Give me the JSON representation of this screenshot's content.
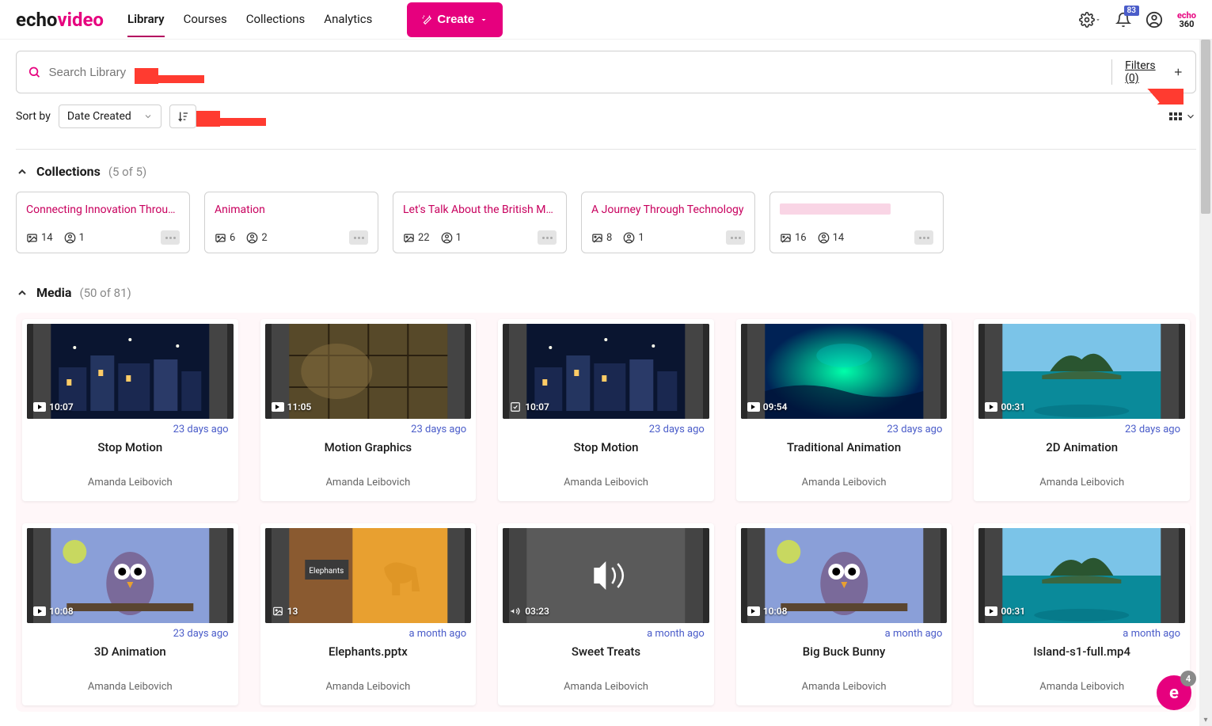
{
  "brand": {
    "part1": "echo",
    "part2": "video",
    "mini1": "echo",
    "mini2": "360"
  },
  "nav": {
    "library": "Library",
    "courses": "Courses",
    "collections": "Collections",
    "analytics": "Analytics"
  },
  "create_btn": "Create",
  "notification_count": "83",
  "search": {
    "placeholder": "Search Library"
  },
  "filters": {
    "label": "Filters (0)"
  },
  "sort": {
    "label": "Sort by",
    "value": "Date Created"
  },
  "collections_section": {
    "title": "Collections",
    "count": "(5 of 5)"
  },
  "collections": [
    {
      "title": "Connecting Innovation Throug...",
      "media": "14",
      "users": "1"
    },
    {
      "title": "Animation",
      "media": "6",
      "users": "2"
    },
    {
      "title": "Let's Talk About the British Mo...",
      "media": "22",
      "users": "1"
    },
    {
      "title": "A Journey Through Technology",
      "media": "8",
      "users": "1"
    },
    {
      "title": "",
      "media": "16",
      "users": "14",
      "blurred": true
    }
  ],
  "media_section": {
    "title": "Media",
    "count": "(50 of 81)"
  },
  "media": [
    {
      "duration": "10:07",
      "date": "23 days ago",
      "title": "Stop Motion",
      "author": "Amanda Leibovich",
      "thumb": "town",
      "icon": "play"
    },
    {
      "duration": "11:05",
      "date": "23 days ago",
      "title": "Motion Graphics",
      "author": "Amanda Leibovich",
      "thumb": "brick",
      "icon": "play"
    },
    {
      "duration": "10:07",
      "date": "23 days ago",
      "title": "Stop Motion",
      "author": "Amanda Leibovich",
      "thumb": "town",
      "icon": "check"
    },
    {
      "duration": "09:54",
      "date": "23 days ago",
      "title": "Traditional Animation",
      "author": "Amanda Leibovich",
      "thumb": "underwater",
      "icon": "play"
    },
    {
      "duration": "00:31",
      "date": "23 days ago",
      "title": "2D Animation",
      "author": "Amanda Leibovich",
      "thumb": "island",
      "icon": "play"
    },
    {
      "duration": "10:08",
      "date": "23 days ago",
      "title": "3D Animation",
      "author": "Amanda Leibovich",
      "thumb": "owl",
      "icon": "play"
    },
    {
      "duration": "13",
      "date": "a month ago",
      "title": "Elephants.pptx",
      "author": "Amanda Leibovich",
      "thumb": "elephants",
      "icon": "image"
    },
    {
      "duration": "03:23",
      "date": "a month ago",
      "title": "Sweet Treats",
      "author": "Amanda Leibovich",
      "thumb": "audio",
      "icon": "audio"
    },
    {
      "duration": "10:08",
      "date": "a month ago",
      "title": "Big Buck Bunny",
      "author": "Amanda Leibovich",
      "thumb": "owl",
      "icon": "play"
    },
    {
      "duration": "00:31",
      "date": "a month ago",
      "title": "Island-s1-full.mp4",
      "author": "Amanda Leibovich",
      "thumb": "island",
      "icon": "play"
    }
  ],
  "chat_badge": "4"
}
